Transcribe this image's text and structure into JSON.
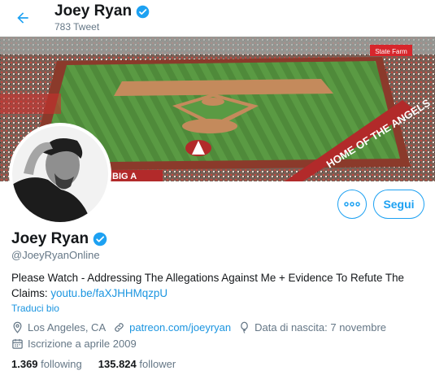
{
  "header": {
    "name": "Joey Ryan",
    "tweet_count": "783 Tweet"
  },
  "profile": {
    "name": "Joey Ryan",
    "handle": "@JoeyRyanOnline",
    "bio_text": "Please Watch - Addressing The Allegations Against Me + Evidence To Refute The Claims: ",
    "bio_link": "youtu.be/faXJHHMqzpU",
    "translate_label": "Traduci bio",
    "location": "Los Angeles, CA",
    "website": "patreon.com/joeyryan",
    "birthday": "Data di nascita: 7 novembre",
    "joined": "Iscrizione a aprile 2009"
  },
  "actions": {
    "follow_label": "Segui"
  },
  "stats": {
    "following_count": "1.369",
    "following_label": "following",
    "followers_count": "135.824",
    "followers_label": "follower"
  },
  "banner_signs": {
    "state_farm": "State Farm",
    "home_of": "HOME OF THE ANGELS",
    "big_a": "BIG A"
  },
  "colors": {
    "accent": "#1da1f2",
    "link": "#1b95e0",
    "secondary_text": "#657786"
  }
}
